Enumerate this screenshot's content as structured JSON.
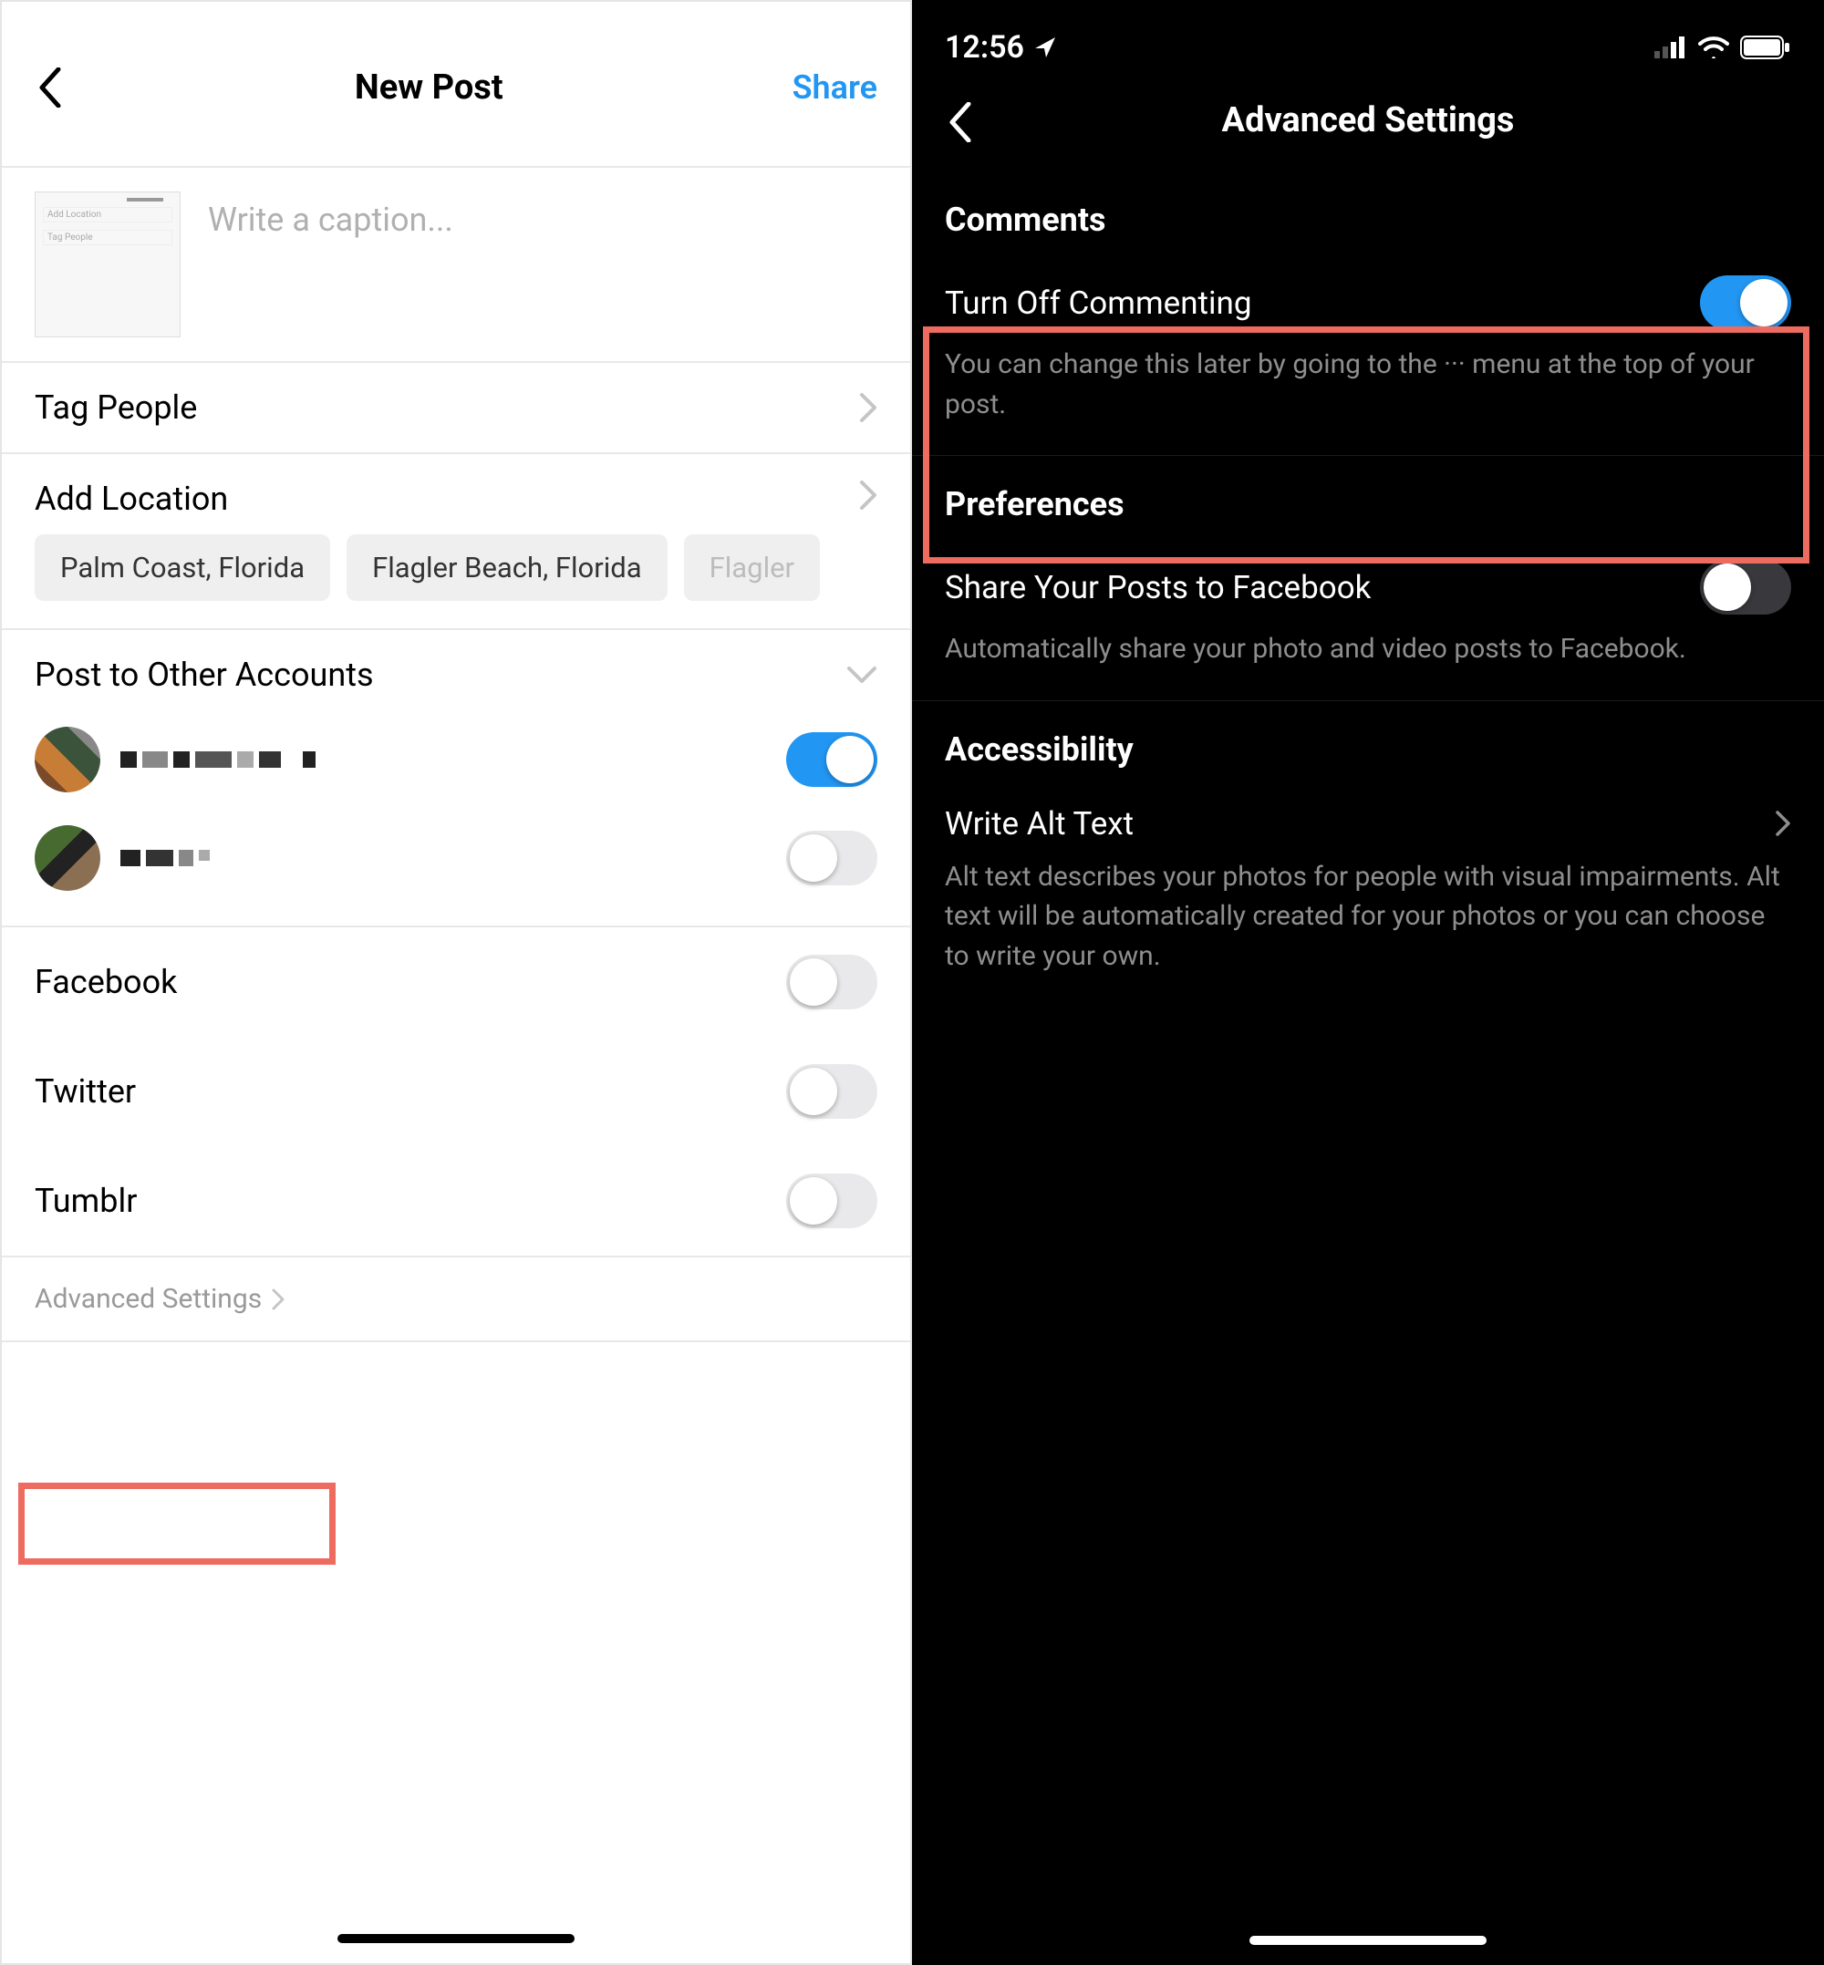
{
  "left": {
    "header": {
      "title": "New Post",
      "share": "Share"
    },
    "caption_placeholder": "Write a caption...",
    "tag_people": "Tag People",
    "add_location": "Add Location",
    "location_chips": [
      "Palm Coast, Florida",
      "Flagler Beach, Florida",
      "Flagler"
    ],
    "post_to_other": "Post to Other Accounts",
    "share_targets": {
      "facebook": "Facebook",
      "twitter": "Twitter",
      "tumblr": "Tumblr"
    },
    "advanced": "Advanced Settings"
  },
  "right": {
    "status_time": "12:56",
    "header_title": "Advanced Settings",
    "sections": {
      "comments": {
        "head": "Comments",
        "toggle_label": "Turn Off Commenting",
        "desc": "You can change this later by going to the ··· menu at the top of your post."
      },
      "preferences": {
        "head": "Preferences",
        "toggle_label": "Share Your Posts to Facebook",
        "desc": "Automatically share your photo and video posts to Facebook."
      },
      "accessibility": {
        "head": "Accessibility",
        "row_label": "Write Alt Text",
        "desc": "Alt text describes your photos for people with visual impairments. Alt text will be automatically created for your photos or you can choose to write your own."
      }
    }
  }
}
